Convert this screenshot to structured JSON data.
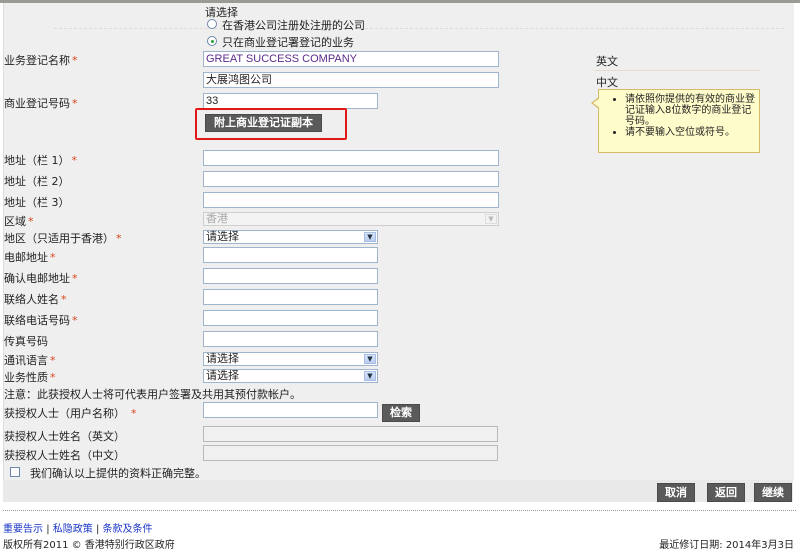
{
  "company_type": {
    "prompt": "请选择",
    "options": [
      {
        "label": "在香港公司注册处注册的公司",
        "selected": false
      },
      {
        "label": "只在商业登记署登记的业务",
        "selected": true
      }
    ]
  },
  "business_name": {
    "label": "业务登记名称",
    "required": "*",
    "english_value": "GREAT SUCCESS COMPANY",
    "chinese_value": "大展鸿图公司",
    "english_tag": "英文",
    "chinese_tag": "中文"
  },
  "br_number": {
    "label": "商业登记号码",
    "required": "*",
    "value": "33",
    "attach_button": "附上商业登记证副本"
  },
  "tooltip": {
    "items": [
      "请依照你提供的有效的商业登记证输入8位数字的商业登记号码。",
      "请不要输入空位或符号。"
    ]
  },
  "address": {
    "line1_label": "地址（栏 1）",
    "line1_required": "*",
    "line2_label": "地址（栏 2）",
    "line3_label": "地址（栏 3）",
    "line1_value": "",
    "line2_value": "",
    "line3_value": ""
  },
  "region": {
    "label": "区域",
    "required": "*",
    "value": "香港"
  },
  "district": {
    "label": "地区（只适用于香港）",
    "required": "*",
    "value": "请选择"
  },
  "email": {
    "label": "电邮地址",
    "required": "*",
    "value": ""
  },
  "confirm_email": {
    "label": "确认电邮地址",
    "required": "*",
    "value": ""
  },
  "contact_name": {
    "label": "联络人姓名",
    "required": "*",
    "value": ""
  },
  "contact_phone": {
    "label": "联络电话号码",
    "required": "*",
    "value": ""
  },
  "fax": {
    "label": "传真号码",
    "value": ""
  },
  "comm_language": {
    "label": "通讯语言",
    "required": "*",
    "value": "请选择"
  },
  "business_nature": {
    "label": "业务性质",
    "required": "*",
    "value": "请选择"
  },
  "notice": "注意：此获授权人士将可代表用户签署及共用其预付款帐户。",
  "authorized_user": {
    "label": "获授权人士（用户名称）",
    "required": "*",
    "value": "",
    "search_button": "检索",
    "name_en_label": "获授权人士姓名（英文）",
    "name_zh_label": "获授权人士姓名（中文）",
    "name_en_value": "",
    "name_zh_value": ""
  },
  "confirm_checkbox": {
    "label": "我们确认以上提供的资料正确完整。",
    "checked": false
  },
  "actions": {
    "cancel": "取消",
    "back": "返回",
    "continue": "继续"
  },
  "footer": {
    "links": [
      "重要告示",
      "私隐政策",
      "条款及条件"
    ],
    "separator": "|",
    "copyright": "版权所有2011 © 香港特别行政区政府",
    "last_revised": "最近修订日期: 2014年3月3日"
  }
}
